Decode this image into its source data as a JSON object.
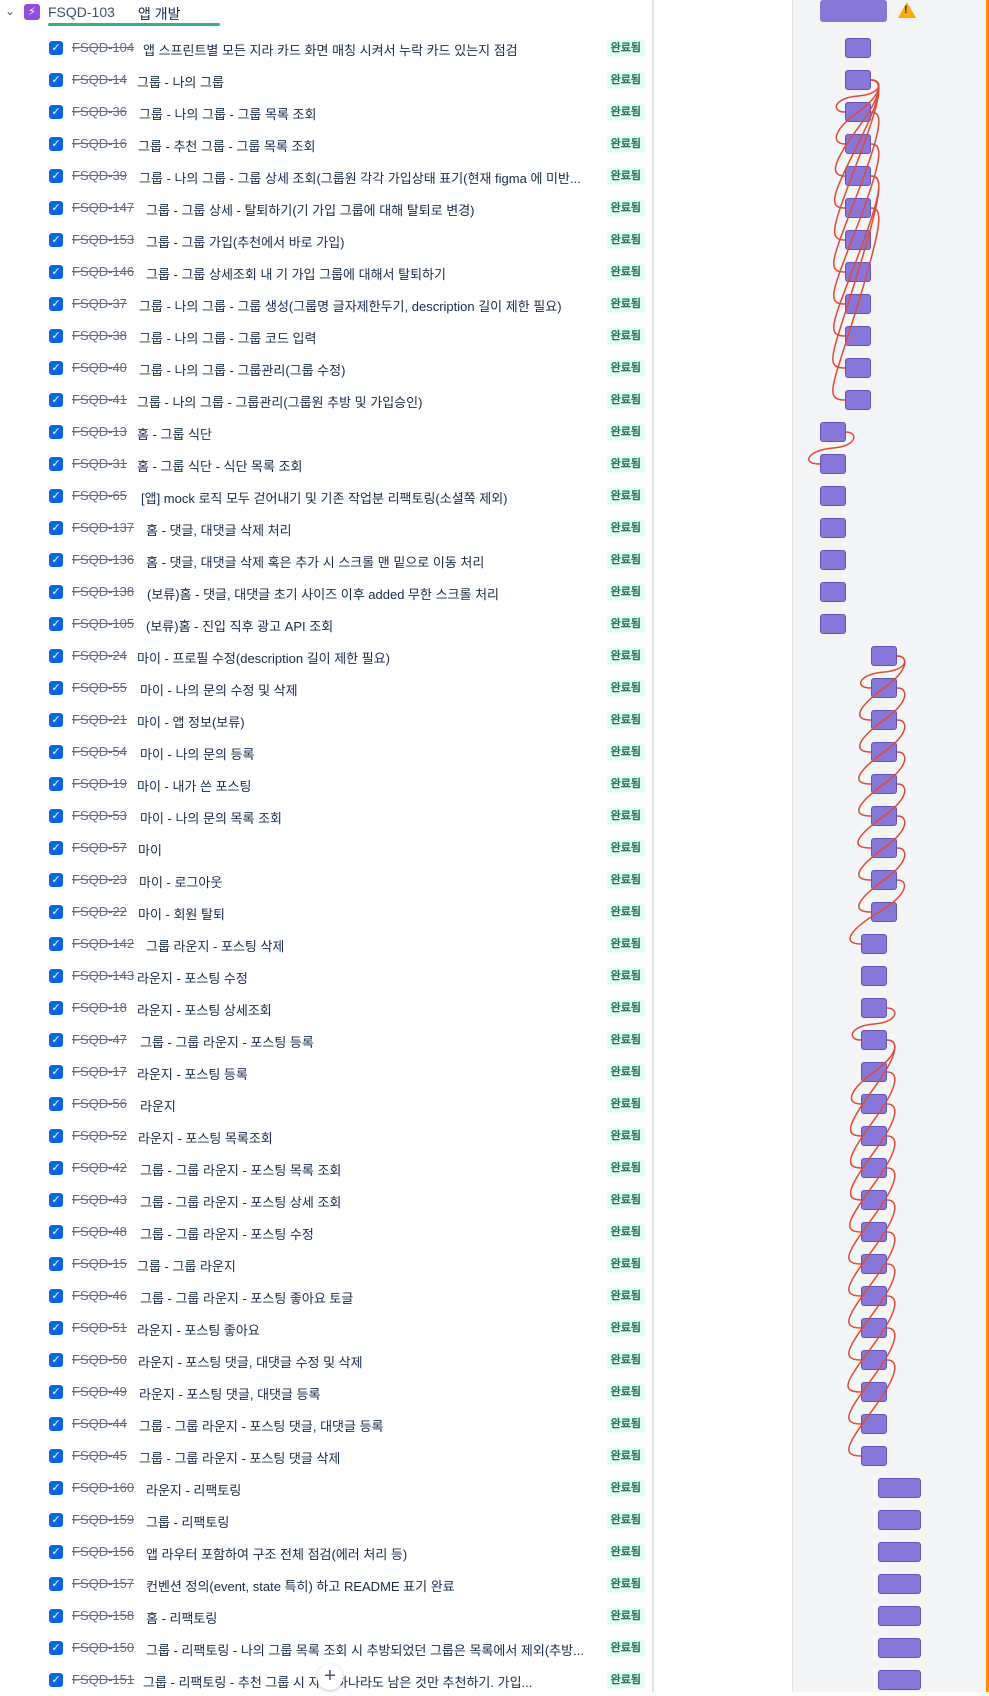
{
  "epic": {
    "key": "FSQD-103",
    "name": "앱 개발",
    "warning_icon": "warning-icon"
  },
  "status_label": "완료됨",
  "add_label": "+",
  "colors": {
    "bar": "#8777d9",
    "dependency": "#e34935",
    "done_badge_bg": "#dcfff1",
    "checkbox": "#0c66e4"
  },
  "issues": [
    {
      "key": "FSQD-104",
      "summary": "앱 스프린트별 모든 지라 카드 화면 매칭 시켜서 누락 카드 있는지 점검"
    },
    {
      "key": "FSQD-14",
      "summary": "그룹 - 나의 그룹"
    },
    {
      "key": "FSQD-36",
      "summary": "그룹 - 나의 그룹 - 그룹 목록 조회"
    },
    {
      "key": "FSQD-16",
      "summary": "그룹 - 추천 그룹 - 그룹 목록 조회"
    },
    {
      "key": "FSQD-39",
      "summary": "그룹 - 나의 그룹 - 그룹 상세 조회(그룹원 각각 가입상태 표기(현재 figma 에 미반..."
    },
    {
      "key": "FSQD-147",
      "summary": "그룹 - 그룹 상세 - 탈퇴하기(기 가입 그룹에 대해 탈퇴로 변경)"
    },
    {
      "key": "FSQD-153",
      "summary": "그룹 - 그룹 가입(추천에서 바로 가입)"
    },
    {
      "key": "FSQD-146",
      "summary": "그룹 - 그룹 상세조회 내 기 가입 그룹에 대해서 탈퇴하기"
    },
    {
      "key": "FSQD-37",
      "summary": "그룹 - 나의 그룹 - 그룹 생성(그룹명 글자제한두기, description 길이 제한 필요)"
    },
    {
      "key": "FSQD-38",
      "summary": "그룹 - 나의 그룹 - 그룹 코드 입력"
    },
    {
      "key": "FSQD-40",
      "summary": "그룹 - 나의 그룹 - 그룹관리(그룹 수정)"
    },
    {
      "key": "FSQD-41",
      "summary": "그룹 - 나의 그룹 - 그룹관리(그룹원 추방 및 가입승인)"
    },
    {
      "key": "FSQD-13",
      "summary": "홈 - 그룹 식단"
    },
    {
      "key": "FSQD-31",
      "summary": "홈 - 그룹 식단 - 식단 목록 조회"
    },
    {
      "key": "FSQD-65",
      "summary": "[앱] mock 로직 모두 걷어내기 및 기존 작업분 리팩토링(소셜쪽 제외)"
    },
    {
      "key": "FSQD-137",
      "summary": "홈 - 댓글, 대댓글 삭제 처리"
    },
    {
      "key": "FSQD-136",
      "summary": "홈 - 댓글, 대댓글 삭제 혹은 추가 시 스크롤 맨 밑으로 이동 처리"
    },
    {
      "key": "FSQD-138",
      "summary": "(보류)홈 - 댓글, 대댓글 초기 사이즈 이후 added 무한 스크롤 처리"
    },
    {
      "key": "FSQD-105",
      "summary": "(보류)홈 - 진입 직후 광고 API 조회"
    },
    {
      "key": "FSQD-24",
      "summary": "마이 - 프로필 수정(description 길이 제한 필요)"
    },
    {
      "key": "FSQD-55",
      "summary": "마이 - 나의 문의 수정 및 삭제"
    },
    {
      "key": "FSQD-21",
      "summary": "마이 - 앱 정보(보류)"
    },
    {
      "key": "FSQD-54",
      "summary": "마이 - 나의 문의 등록"
    },
    {
      "key": "FSQD-19",
      "summary": "마이 - 내가 쓴 포스팅"
    },
    {
      "key": "FSQD-53",
      "summary": "마이 - 나의 문의 목록 조회"
    },
    {
      "key": "FSQD-57",
      "summary": "마이"
    },
    {
      "key": "FSQD-23",
      "summary": "마이 - 로그아웃"
    },
    {
      "key": "FSQD-22",
      "summary": "마이 - 회원 탈퇴"
    },
    {
      "key": "FSQD-142",
      "summary": "그룹 라운지 - 포스팅 삭제"
    },
    {
      "key": "FSQD-143",
      "summary": "라운지 - 포스팅 수정"
    },
    {
      "key": "FSQD-18",
      "summary": "라운지 - 포스팅 상세조회"
    },
    {
      "key": "FSQD-47",
      "summary": "그룹 - 그룹 라운지 - 포스팅 등록"
    },
    {
      "key": "FSQD-17",
      "summary": "라운지 - 포스팅 등록"
    },
    {
      "key": "FSQD-56",
      "summary": "라운지"
    },
    {
      "key": "FSQD-52",
      "summary": "라운지 - 포스팅 목록조회"
    },
    {
      "key": "FSQD-42",
      "summary": "그룹 - 그룹 라운지 - 포스팅 목록 조회"
    },
    {
      "key": "FSQD-43",
      "summary": "그룹 - 그룹 라운지 - 포스팅 상세 조회"
    },
    {
      "key": "FSQD-48",
      "summary": "그룹 - 그룹 라운지 - 포스팅 수정"
    },
    {
      "key": "FSQD-15",
      "summary": "그룹 - 그룹 라운지"
    },
    {
      "key": "FSQD-46",
      "summary": "그룹 - 그룹 라운지 - 포스팅 좋아요 토글"
    },
    {
      "key": "FSQD-51",
      "summary": "라운지 - 포스팅 좋아요"
    },
    {
      "key": "FSQD-50",
      "summary": "라운지 - 포스팅 댓글, 대댓글 수정 및 삭제"
    },
    {
      "key": "FSQD-49",
      "summary": "라운지 - 포스팅 댓글, 대댓글 등록"
    },
    {
      "key": "FSQD-44",
      "summary": "그룹 - 그룹 라운지 - 포스팅 댓글, 대댓글 등록"
    },
    {
      "key": "FSQD-45",
      "summary": "그룹 - 그룹 라운지 - 포스팅 댓글 삭제"
    },
    {
      "key": "FSQD-160",
      "summary": "라운지 - 리팩토링"
    },
    {
      "key": "FSQD-159",
      "summary": "그룹 - 리팩토링"
    },
    {
      "key": "FSQD-156",
      "summary": "앱 라우터 포함하여 구조 전체 점검(에러 처리 등)"
    },
    {
      "key": "FSQD-157",
      "summary": "컨벤션 정의(event, state 특히) 하고 README 표기 완료"
    },
    {
      "key": "FSQD-158",
      "summary": "홈 - 리팩토링"
    },
    {
      "key": "FSQD-150",
      "summary": "그룹 - 리팩토링 - 나의 그룹 목록 조회 시 추방되었던 그룹은 목록에서 제외(추방..."
    },
    {
      "key": "FSQD-151",
      "summary": "그룹 - 리팩토링 - 추천 그룹 시 자리 하나라도 남은 것만 추천하기. 가입..."
    }
  ]
}
